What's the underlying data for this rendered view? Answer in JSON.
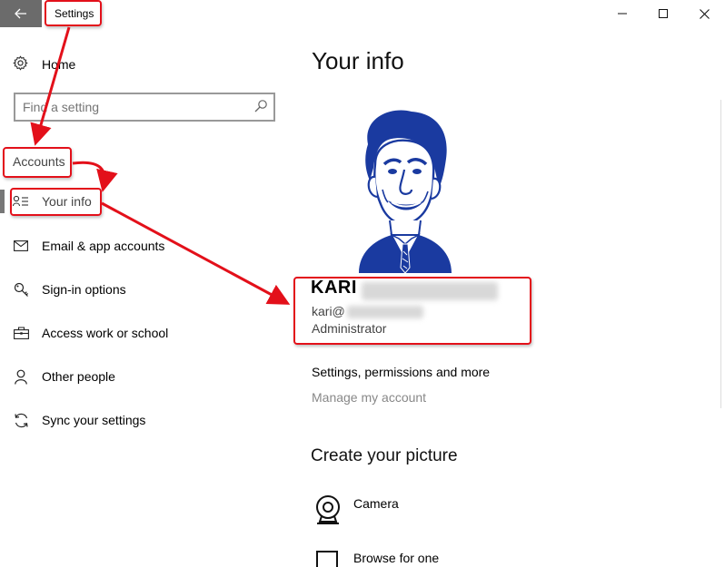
{
  "titlebar": {
    "title": "Settings",
    "back_icon": "back-arrow-icon",
    "minimize_glyph": "—",
    "maximize_glyph": "☐",
    "close_glyph": "✕"
  },
  "sidebar": {
    "home_label": "Home",
    "search_placeholder": "Find a setting",
    "section_header": "Accounts",
    "items": [
      {
        "label": "Your info",
        "icon": "person-info-icon",
        "active": true
      },
      {
        "label": "Email & app accounts",
        "icon": "mail-icon",
        "active": false
      },
      {
        "label": "Sign-in options",
        "icon": "key-icon",
        "active": false
      },
      {
        "label": "Access work or school",
        "icon": "briefcase-icon",
        "active": false
      },
      {
        "label": "Other people",
        "icon": "person-icon",
        "active": false
      },
      {
        "label": "Sync your settings",
        "icon": "sync-icon",
        "active": false
      }
    ]
  },
  "main": {
    "page_title": "Your info",
    "user": {
      "name_visible": "KARI",
      "email_visible": "kari@",
      "role": "Administrator"
    },
    "settings_permissions": "Settings, permissions and more",
    "manage_account": "Manage my account",
    "create_picture_heading": "Create your picture",
    "options": [
      {
        "label": "Camera",
        "icon": "camera-icon"
      },
      {
        "label": "Browse for one",
        "icon": "browse-icon"
      }
    ]
  },
  "colors": {
    "annotation_red": "#e3101a",
    "avatar_blue": "#1a3aa0",
    "titlebar_back_bg": "#6b6b6b"
  }
}
